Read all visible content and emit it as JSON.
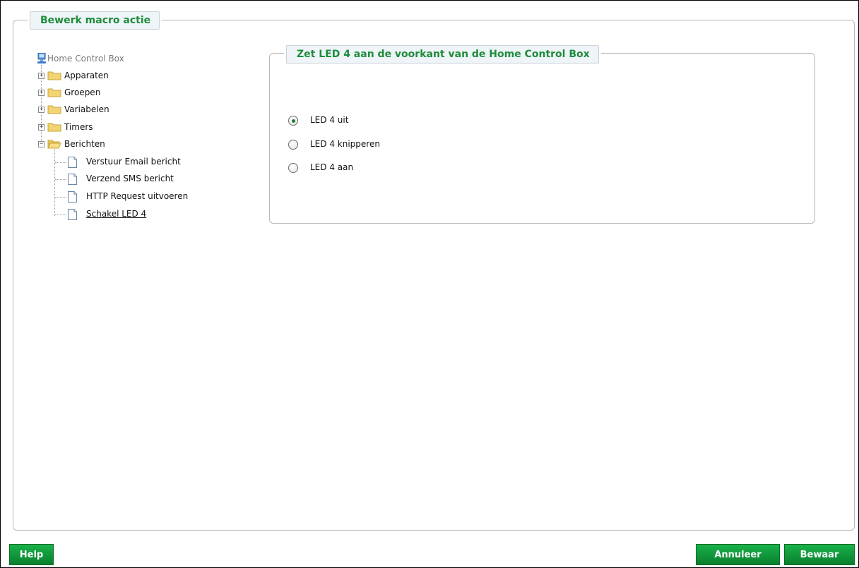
{
  "dialog": {
    "title": "Bewerk macro actie"
  },
  "tree": {
    "root_label": "Home Control Box",
    "folders": [
      {
        "label": "Apparaten",
        "expanded": false
      },
      {
        "label": "Groepen",
        "expanded": false
      },
      {
        "label": "Variabelen",
        "expanded": false
      },
      {
        "label": "Timers",
        "expanded": false
      },
      {
        "label": "Berichten",
        "expanded": true
      }
    ],
    "berichten_children": [
      "Verstuur Email bericht",
      "Verzend SMS bericht",
      "HTTP Request uitvoeren",
      "Schakel LED 4"
    ],
    "selected": "Schakel LED 4"
  },
  "panel": {
    "title": "Zet LED 4 aan de voorkant van de Home Control Box",
    "options": [
      {
        "label": "LED 4 uit",
        "checked": true
      },
      {
        "label": "LED 4 knipperen",
        "checked": false
      },
      {
        "label": "LED 4 aan",
        "checked": false
      }
    ]
  },
  "buttons": {
    "help": "Help",
    "cancel": "Annuleer",
    "save": "Bewaar"
  },
  "colors": {
    "accent_green": "#1e8c3a",
    "button_green": "#0f9a3b",
    "folder_yellow": "#f2d472"
  }
}
